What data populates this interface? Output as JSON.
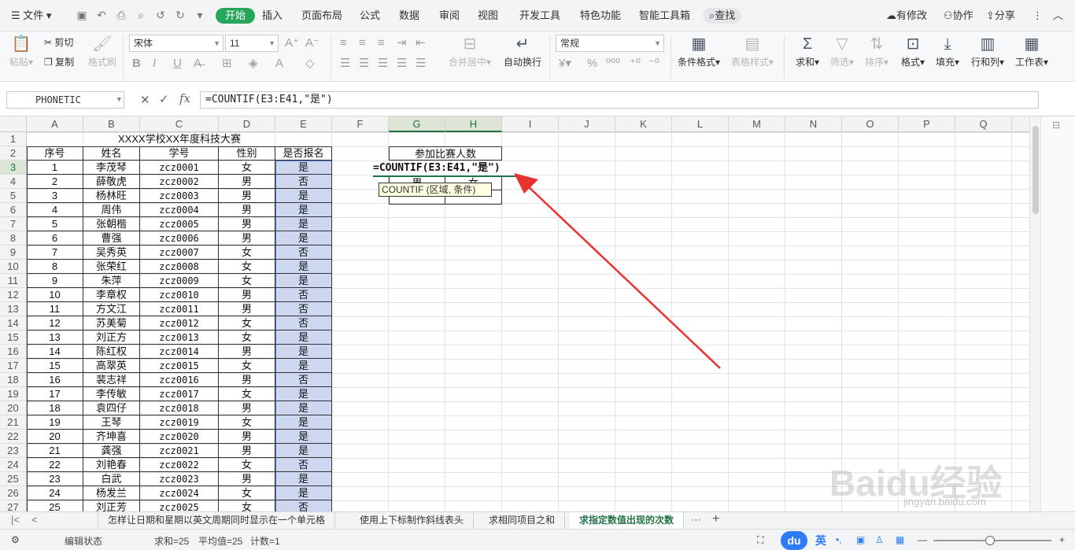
{
  "menubar": {
    "file": "文件",
    "tabs": [
      "开始",
      "插入",
      "页面布局",
      "公式",
      "数据",
      "审阅",
      "视图",
      "开发工具",
      "特色功能",
      "智能工具箱"
    ],
    "search": "查找",
    "right": [
      "有修改",
      "协作",
      "分享"
    ]
  },
  "ribbon": {
    "paste": "粘贴",
    "cut": "剪切",
    "copy": "复制",
    "format_painter": "格式刷",
    "font_name": "宋体",
    "font_size": "11",
    "merge_center": "合并居中",
    "wrap_text": "自动换行",
    "number_format": "常规",
    "conditional_format": "条件格式",
    "table_style": "表格样式",
    "sum": "求和",
    "filter": "筛选",
    "sort": "排序",
    "format": "格式",
    "fill": "填充",
    "row_col": "行和列",
    "worksheet": "工作表"
  },
  "formula_bar": {
    "name_box": "PHONETIC",
    "formula": "=COUNTIF(E3:E41,\"是\")"
  },
  "columns": [
    "A",
    "B",
    "C",
    "D",
    "E",
    "F",
    "G",
    "H",
    "I",
    "J",
    "K",
    "L",
    "M",
    "N",
    "O",
    "P",
    "Q"
  ],
  "row_numbers": [
    "1",
    "2",
    "3",
    "4",
    "5",
    "6",
    "7",
    "8",
    "9",
    "10",
    "11",
    "12",
    "13",
    "14",
    "15",
    "16",
    "17",
    "18",
    "19",
    "20",
    "21",
    "22",
    "23",
    "24",
    "25",
    "26",
    "27"
  ],
  "sheet": {
    "title": "XXXX学校XX年度科技大赛",
    "headers": [
      "序号",
      "姓名",
      "学号",
      "性别",
      "是否报名"
    ],
    "rows": [
      [
        "1",
        "李茂琴",
        "zcz0001",
        "女",
        "是"
      ],
      [
        "2",
        "薛敬虎",
        "zcz0002",
        "男",
        "否"
      ],
      [
        "3",
        "杨林旺",
        "zcz0003",
        "男",
        "是"
      ],
      [
        "4",
        "周伟",
        "zcz0004",
        "男",
        "是"
      ],
      [
        "5",
        "张朝楷",
        "zcz0005",
        "男",
        "是"
      ],
      [
        "6",
        "曹强",
        "zcz0006",
        "男",
        "是"
      ],
      [
        "7",
        "吴秀英",
        "zcz0007",
        "女",
        "否"
      ],
      [
        "8",
        "张荣红",
        "zcz0008",
        "女",
        "是"
      ],
      [
        "9",
        "朱萍",
        "zcz0009",
        "女",
        "是"
      ],
      [
        "10",
        "李章权",
        "zcz0010",
        "男",
        "否"
      ],
      [
        "11",
        "方文江",
        "zcz0011",
        "男",
        "否"
      ],
      [
        "12",
        "苏美菊",
        "zcz0012",
        "女",
        "否"
      ],
      [
        "13",
        "刘正方",
        "zcz0013",
        "女",
        "是"
      ],
      [
        "14",
        "陈红权",
        "zcz0014",
        "男",
        "是"
      ],
      [
        "15",
        "高翠英",
        "zcz0015",
        "女",
        "是"
      ],
      [
        "16",
        "裴志祥",
        "zcz0016",
        "男",
        "否"
      ],
      [
        "17",
        "李传敏",
        "zcz0017",
        "女",
        "是"
      ],
      [
        "18",
        "袁四仔",
        "zcz0018",
        "男",
        "是"
      ],
      [
        "19",
        "王琴",
        "zcz0019",
        "女",
        "是"
      ],
      [
        "20",
        "齐坤喜",
        "zcz0020",
        "男",
        "是"
      ],
      [
        "21",
        "龚强",
        "zcz0021",
        "男",
        "是"
      ],
      [
        "22",
        "刘艳春",
        "zcz0022",
        "女",
        "否"
      ],
      [
        "23",
        "白武",
        "zcz0023",
        "男",
        "是"
      ],
      [
        "24",
        "杨发兰",
        "zcz0024",
        "女",
        "是"
      ],
      [
        "25",
        "刘正芳",
        "zcz0025",
        "女",
        "否"
      ]
    ],
    "side_table": {
      "title": "参加比赛人数",
      "male": "男",
      "female": "女",
      "editing_formula": "=COUNTIF(E3:E41,\"是\")",
      "tooltip": "COUNTIF (区域, 条件)"
    }
  },
  "sheet_tabs": [
    "怎样让日期和星期以英文周期同时显示在一个单元格",
    "使用上下标制作斜线表头",
    "求相同项目之和",
    "求指定数值出现的次数"
  ],
  "status": {
    "mode": "编辑状态",
    "sum": "求和=25",
    "avg": "平均值=25",
    "count": "计数=1"
  },
  "ime": "英",
  "watermark": "Baidu经验",
  "watermark_url": "jingyan.baidu.com"
}
